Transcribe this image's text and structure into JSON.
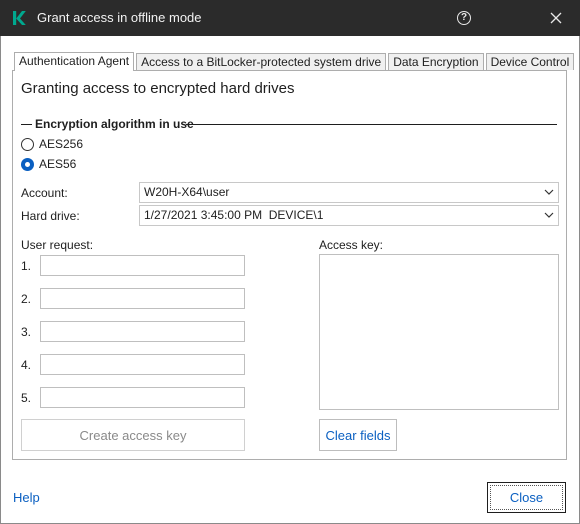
{
  "window": {
    "title": "Grant access in offline mode",
    "help_glyph": "?",
    "close_glyph": "×"
  },
  "tabs": [
    {
      "label": "Authentication Agent",
      "active": true
    },
    {
      "label": "Access to a BitLocker-protected system drive",
      "active": false
    },
    {
      "label": "Data Encryption",
      "active": false
    },
    {
      "label": "Device Control",
      "active": false
    }
  ],
  "main": {
    "heading": "Granting access to encrypted hard drives",
    "algorithm_group": "Encryption algorithm in use",
    "algorithms": [
      {
        "label": "AES256",
        "checked": false
      },
      {
        "label": "AES56",
        "checked": true
      }
    ],
    "account_label": "Account:",
    "account_value": "W20H-X64\\user",
    "hard_drive_label": "Hard drive:",
    "hard_drive_value": "1/27/2021 3:45:00 PM  DEVICE\\1",
    "user_request_label": "User request:",
    "request_numbers": [
      "1.",
      "2.",
      "3.",
      "4.",
      "5."
    ],
    "access_key_label": "Access key:",
    "create_button": "Create access key",
    "clear_button": "Clear fields"
  },
  "footer": {
    "help": "Help",
    "close": "Close"
  },
  "colors": {
    "titlebar": "#2b2b2b",
    "accent": "#0a5fc1",
    "logo": "#00a88e"
  },
  "icons": [
    "kaspersky-logo-icon",
    "help-icon",
    "close-icon",
    "chevron-down-icon"
  ]
}
